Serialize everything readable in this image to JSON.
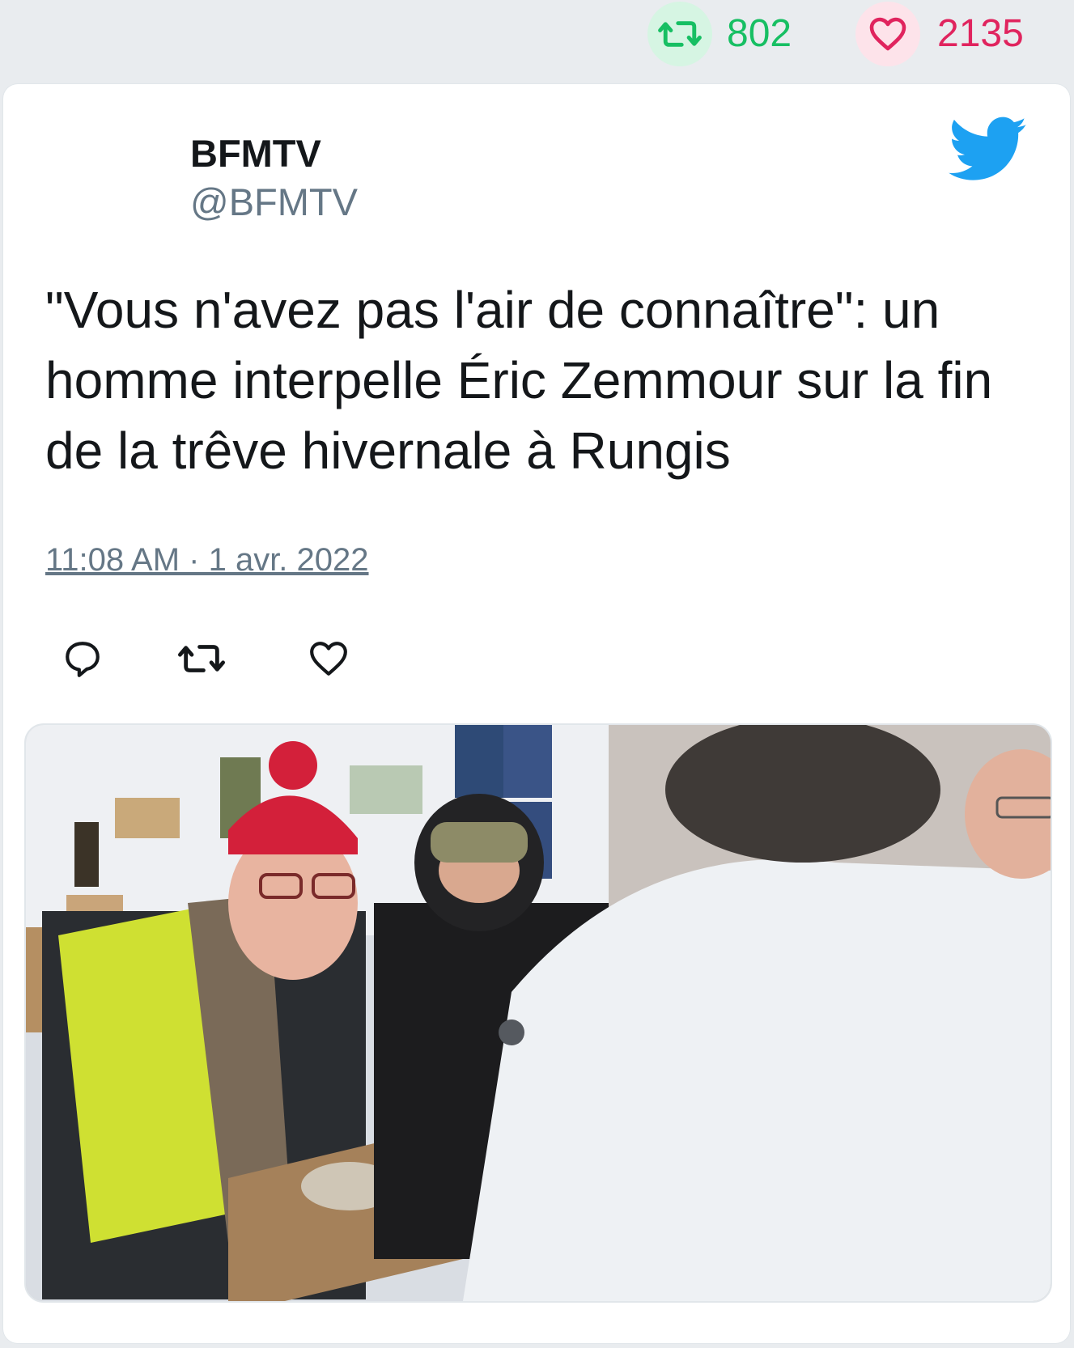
{
  "stats": {
    "retweets": "802",
    "likes": "2135",
    "retweet_icon": "retweet-icon",
    "like_icon": "heart-icon"
  },
  "tweet": {
    "author_name": "BFMTV",
    "author_handle": "@BFMTV",
    "text": "\"Vous n'avez pas l'air de connaître\": un homme interpelle Éric Zemmour sur la fin de la trêve hivernale à Rungis",
    "timestamp": "11:08 AM · 1 avr. 2022"
  },
  "actions": [
    "reply-icon",
    "retweet-icon",
    "heart-icon"
  ],
  "colors": {
    "retweet_green": "#17bf63",
    "like_red": "#e0245e",
    "twitter_blue": "#1da1f2",
    "muted": "#657786"
  }
}
